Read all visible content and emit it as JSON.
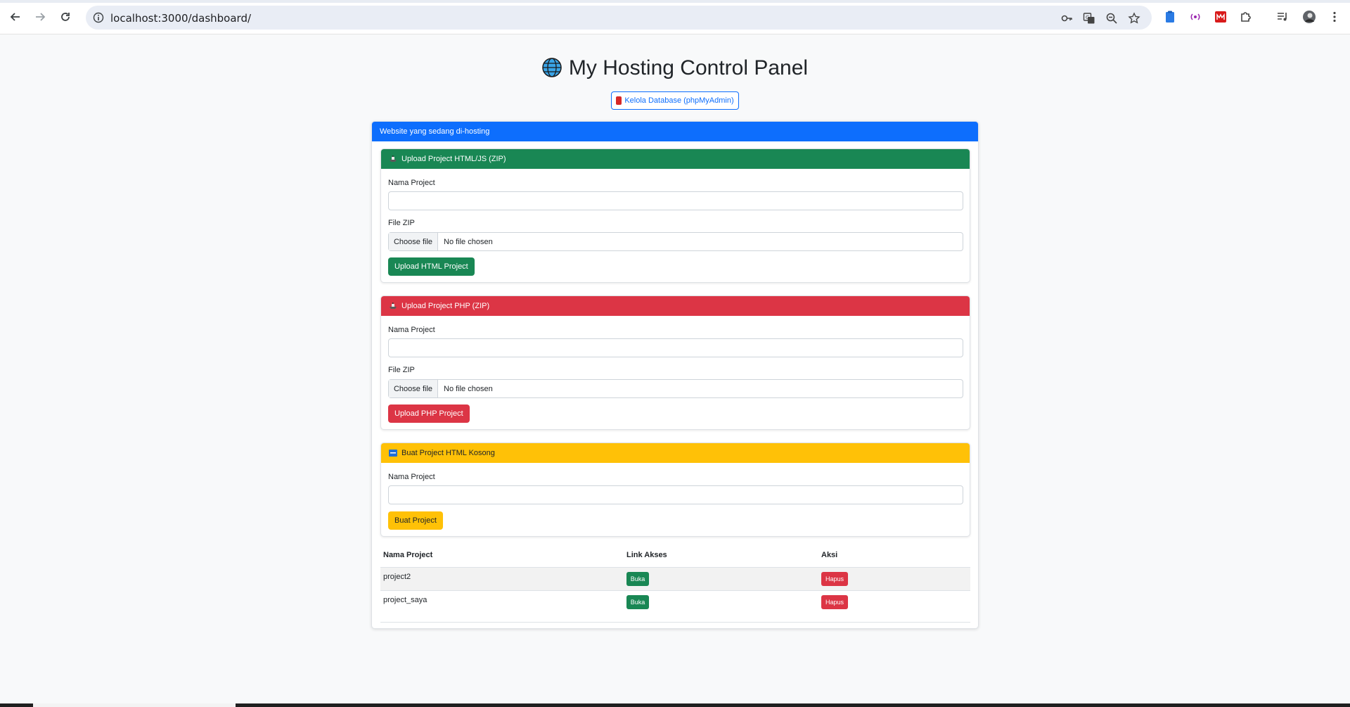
{
  "browser": {
    "url": "localhost:3000/dashboard/",
    "icons": [
      "back-icon",
      "forward-icon",
      "reload-icon",
      "info-icon",
      "key-icon",
      "translate-icon",
      "zoom-icon",
      "star-icon",
      "clipboard-ext-icon",
      "cast-ext-icon",
      "red-ext-icon",
      "puzzle-icon",
      "media-icon",
      "profile-avatar",
      "more-icon"
    ]
  },
  "page": {
    "title": "My Hosting Control Panel",
    "db_button": "Kelola Database (phpMyAdmin)"
  },
  "main_card": {
    "header": "Website yang sedang di-hosting"
  },
  "html_upload": {
    "header": "Upload Project HTML/JS (ZIP)",
    "name_label": "Nama Project",
    "name_value": "",
    "file_label": "File ZIP",
    "choose_file": "Choose file",
    "no_file": "No file chosen",
    "submit": "Upload HTML Project"
  },
  "php_upload": {
    "header": "Upload Project PHP (ZIP)",
    "name_label": "Nama Project",
    "name_value": "",
    "file_label": "File ZIP",
    "choose_file": "Choose file",
    "no_file": "No file chosen",
    "submit": "Upload PHP Project"
  },
  "blank_project": {
    "header": "Buat Project HTML Kosong",
    "name_label": "Nama Project",
    "name_value": "",
    "submit": "Buat Project"
  },
  "projects_table": {
    "columns": [
      "Nama Project",
      "Link Akses",
      "Aksi"
    ],
    "rows": [
      {
        "name": "project2",
        "open": "Buka",
        "delete": "Hapus"
      },
      {
        "name": "project_saya",
        "open": "Buka",
        "delete": "Hapus"
      }
    ]
  },
  "colors": {
    "primary": "#0d6efd",
    "success": "#198754",
    "danger": "#dc3545",
    "warning": "#ffc107"
  }
}
